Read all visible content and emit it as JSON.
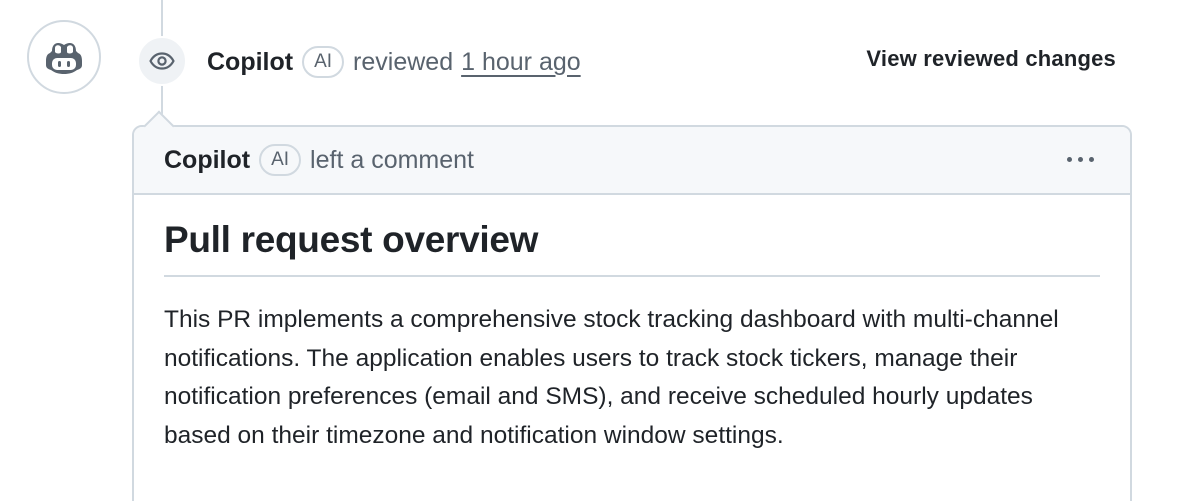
{
  "event": {
    "author": "Copilot",
    "ai_badge": "AI",
    "action": "reviewed",
    "time": "1 hour ago",
    "view_changes": "View reviewed changes"
  },
  "comment": {
    "author": "Copilot",
    "ai_badge": "AI",
    "action": "left a comment",
    "title": "Pull request overview",
    "body": "This PR implements a comprehensive stock tracking dashboard with multi-channel notifications. The application enables users to track stock tickers, manage their notification preferences (email and SMS), and receive scheduled hourly updates based on their timezone and notification window settings."
  },
  "icons": {
    "avatar": "copilot-icon",
    "badge": "eye-icon",
    "menu": "kebab-horizontal-icon"
  },
  "colors": {
    "text": "#1f2328",
    "muted": "#59636e",
    "border": "#d1d9e0",
    "header_bg": "#f6f8fa"
  }
}
